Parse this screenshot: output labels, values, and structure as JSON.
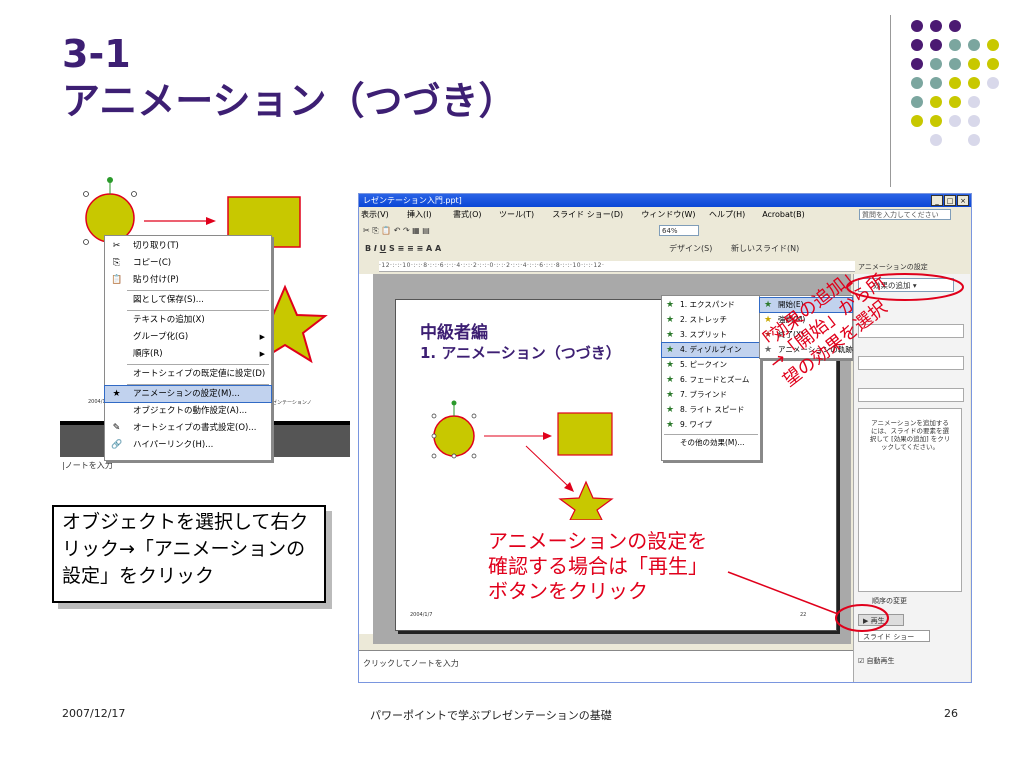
{
  "slide": {
    "title_line1": "3-1",
    "title_line2": "アニメーション（つづき）",
    "footer_date": "2007/12/17",
    "footer_title": "パワーポイントで学ぶプレゼンテーションの基礎",
    "footer_page": "26"
  },
  "colors": {
    "title": "#3d1f73",
    "accent_red": "#e0001b",
    "shape_fill": "#c8c800",
    "shape_border": "#e0001b"
  },
  "left_shot": {
    "context_menu": [
      {
        "icon": "scissors-icon",
        "label": "切り取り(T)"
      },
      {
        "icon": "copy-icon",
        "label": "コピー(C)"
      },
      {
        "icon": "paste-icon",
        "label": "貼り付け(P)"
      },
      {
        "icon": "",
        "label": "図として保存(S)..."
      },
      {
        "icon": "",
        "label": "テキストの追加(X)"
      },
      {
        "icon": "",
        "label": "グループ化(G)",
        "sub": true
      },
      {
        "icon": "",
        "label": "順序(R)",
        "sub": true
      },
      {
        "icon": "",
        "label": "オートシェイプの既定値に設定(D)"
      },
      {
        "icon": "animation-icon",
        "label": "アニメーションの設定(M)...",
        "selected": true
      },
      {
        "icon": "",
        "label": "オブジェクトの動作設定(A)..."
      },
      {
        "icon": "format-icon",
        "label": "オートシェイプの書式設定(O)..."
      },
      {
        "icon": "link-icon",
        "label": "ハイパーリンク(H)..."
      }
    ],
    "slide_date": "2004/1/7",
    "slide_footer_text": "ゼンテーションノ",
    "notes_text": "|ノートを入力"
  },
  "callout_left": "オブジェクトを選択して右クリック→「アニメーションの設定」をクリック",
  "main_window": {
    "title": "レゼンテーション入門.ppt]",
    "menu": [
      "表示(V)",
      "挿入(I)",
      "書式(O)",
      "ツール(T)",
      "スライド ショー(D)",
      "ウィンドウ(W)",
      "ヘルプ(H)",
      "Acrobat(B)"
    ],
    "help_placeholder": "質問を入力してください",
    "zoom": "64%",
    "design_button": "デザイン(S)",
    "new_slide_button": "新しいスライド(N)",
    "task_pane_title": "アニメーションの設定",
    "add_effect_button": "効果の追加",
    "task_pane_hint": "アニメーションを追加するには、スライドの要素を選択して [効果の追加] をクリックしてください。",
    "order_change": "順序の変更",
    "play_button": "再生",
    "slideshow_button": "スライド ショー",
    "autoplay_label": "自動再生",
    "notes_placeholder": "クリックしてノートを入力",
    "slide_title1": "中級者編",
    "slide_title2": "1. アニメーション（つづき）",
    "slide_date": "2004/1/7",
    "slide_page": "22",
    "effect_menu": [
      {
        "label": "開始(E)",
        "selected": true
      },
      {
        "label": "強調(M)"
      },
      {
        "label": "終了(X)"
      },
      {
        "label": "アニメーションの軌跡(P)"
      }
    ],
    "start_submenu": [
      {
        "label": "1. エクスパンド"
      },
      {
        "label": "2. ストレッチ"
      },
      {
        "label": "3. スプリット"
      },
      {
        "label": "4. ディゾルブイン",
        "selected": true
      },
      {
        "label": "5. ピークイン"
      },
      {
        "label": "6. フェードとズーム"
      },
      {
        "label": "7. ブラインド"
      },
      {
        "label": "8. ライト スピード"
      },
      {
        "label": "9. ワイプ"
      },
      {
        "label": "その他の効果(M)..."
      }
    ]
  },
  "annotation_rotated": [
    "「効果の追加」",
    "→「開始」から所",
    "望の効果を選択"
  ],
  "annotation_play": [
    "アニメーションの設定を",
    "確認する場合は「再生」",
    "ボタンをクリック"
  ]
}
